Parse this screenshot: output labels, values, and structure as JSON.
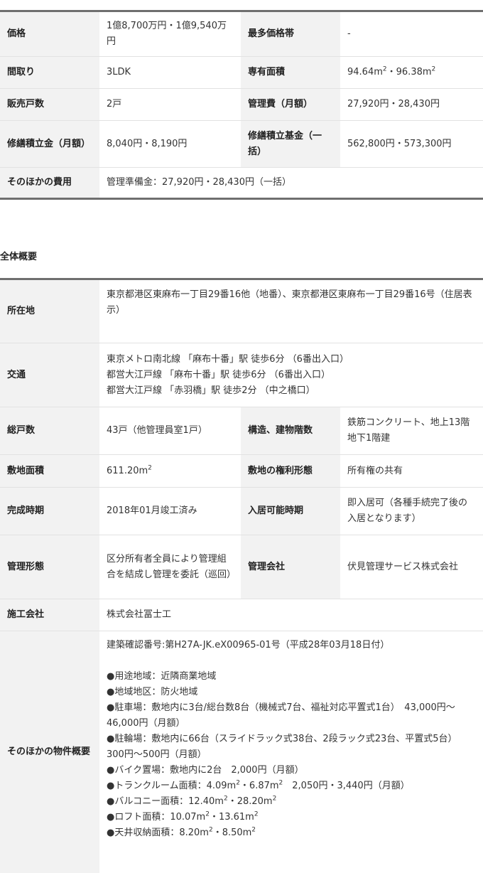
{
  "price_table": {
    "price_label": "価格",
    "price_value": "1億8,700万円・1億9,540万円",
    "top_price_label": "最多価格帯",
    "top_price_value": "-",
    "layout_label": "間取り",
    "layout_value": "3LDK",
    "area_label": "専有面積",
    "area_a": "94.64m",
    "area_b": "96.38m",
    "area_sep": "・",
    "sup2": "2",
    "units_label": "販売戸数",
    "units_value": "2戸",
    "mgmt_fee_label": "管理費（月額）",
    "mgmt_fee_value": "27,920円・28,430円",
    "repair_label": "修繕積立金（月額）",
    "repair_value": "8,040円・8,190円",
    "repair_fund_label": "修繕積立基金（一括）",
    "repair_fund_value": "562,800円・573,300円",
    "other_cost_label": "そのほかの費用",
    "other_cost_value": "管理準備金：27,920円・28,430円（一括）"
  },
  "overview": {
    "title": "全体概要",
    "location_label": "所在地",
    "location_value": "東京都港区東麻布一丁目29番16他（地番）、東京都港区東麻布一丁目29番16号（住居表示）",
    "access_label": "交通",
    "access_lines": [
      "東京メトロ南北線 「麻布十番」駅 徒歩6分 （6番出入口）",
      "都営大江戸線 「麻布十番」駅 徒歩6分 （6番出入口）",
      "都営大江戸線 「赤羽橋」駅 徒歩2分 （中之橋口）"
    ],
    "total_units_label": "総戸数",
    "total_units_value": "43戸（他管理員室1戸）",
    "structure_label": "構造、建物階数",
    "structure_value": "鉄筋コンクリート、地上13階　地下1階建",
    "site_area_label": "敷地面積",
    "site_area_value": "611.20m",
    "land_rights_label": "敷地の権利形態",
    "land_rights_value": "所有権の共有",
    "completion_label": "完成時期",
    "completion_value": "2018年01月竣工済み",
    "move_in_label": "入居可能時期",
    "move_in_value": "即入居可（各種手続完了後の入居となります）",
    "mgmt_form_label": "管理形態",
    "mgmt_form_value": "区分所有者全員により管理組合を結成し管理を委託（巡回）",
    "mgmt_company_label": "管理会社",
    "mgmt_company_value": "伏見管理サービス株式会社",
    "builder_label": "施工会社",
    "builder_value": "株式会社冨士工",
    "other_label": "そのほかの物件概要",
    "permit": "建築確認番号:第H27A-JK.eX00965-01号（平成28年03月18日付）",
    "use_zone": "●用途地域：近隣商業地域",
    "district": "●地域地区：防火地域",
    "parking": "●駐車場：敷地内に3台/総台数8台（機械式7台、福祉対応平置式1台）　43,000円～46,000円（月額）",
    "bicycle": "●駐輪場：敷地内に66台（スライドラック式38台、2段ラック式23台、平置式5台）　300円～500円（月額）",
    "bike": "●バイク置場：敷地内に2台　2,000円（月額）",
    "trunk_prefix": "●トランクルーム面積：4.09m",
    "trunk_mid": "・6.87m",
    "trunk_suffix": "　2,050円・3,440円（月額）",
    "balcony_prefix": "●バルコニー面積：12.40m",
    "balcony_mid": "・28.20m",
    "loft_prefix": "●ロフト面積：10.07m",
    "loft_mid": "・13.61m",
    "ceiling_prefix": "●天井収納面積：8.20m",
    "ceiling_mid": "・8.50m"
  }
}
